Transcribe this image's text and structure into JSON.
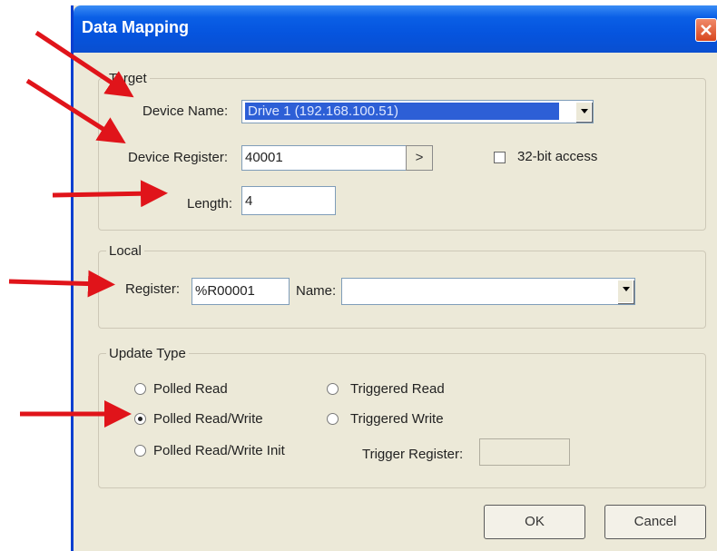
{
  "window": {
    "title": "Data Mapping"
  },
  "target": {
    "legend": "Target",
    "device_name_label": "Device Name:",
    "device_name_value": "Drive 1 (192.168.100.51)",
    "device_register_label": "Device Register:",
    "device_register_value": "40001",
    "browse_button": ">",
    "access_32bit_label": "32-bit access",
    "length_label": "Length:",
    "length_value": "4"
  },
  "local": {
    "legend": "Local",
    "register_label": "Register:",
    "register_value": "%R00001",
    "name_label": "Name:",
    "name_value": ""
  },
  "update_type": {
    "legend": "Update Type",
    "options": [
      "Polled Read",
      "Triggered Read",
      "Polled Read/Write",
      "Triggered Write",
      "Polled Read/Write Init"
    ],
    "selected": "Polled Read/Write",
    "trigger_register_label": "Trigger Register:",
    "trigger_register_value": ""
  },
  "buttons": {
    "ok": "OK",
    "cancel": "Cancel"
  },
  "colors": {
    "annotation_arrow": "#e0141a",
    "titlebar": "#0a5fe6",
    "selection": "#2d5fd6"
  }
}
